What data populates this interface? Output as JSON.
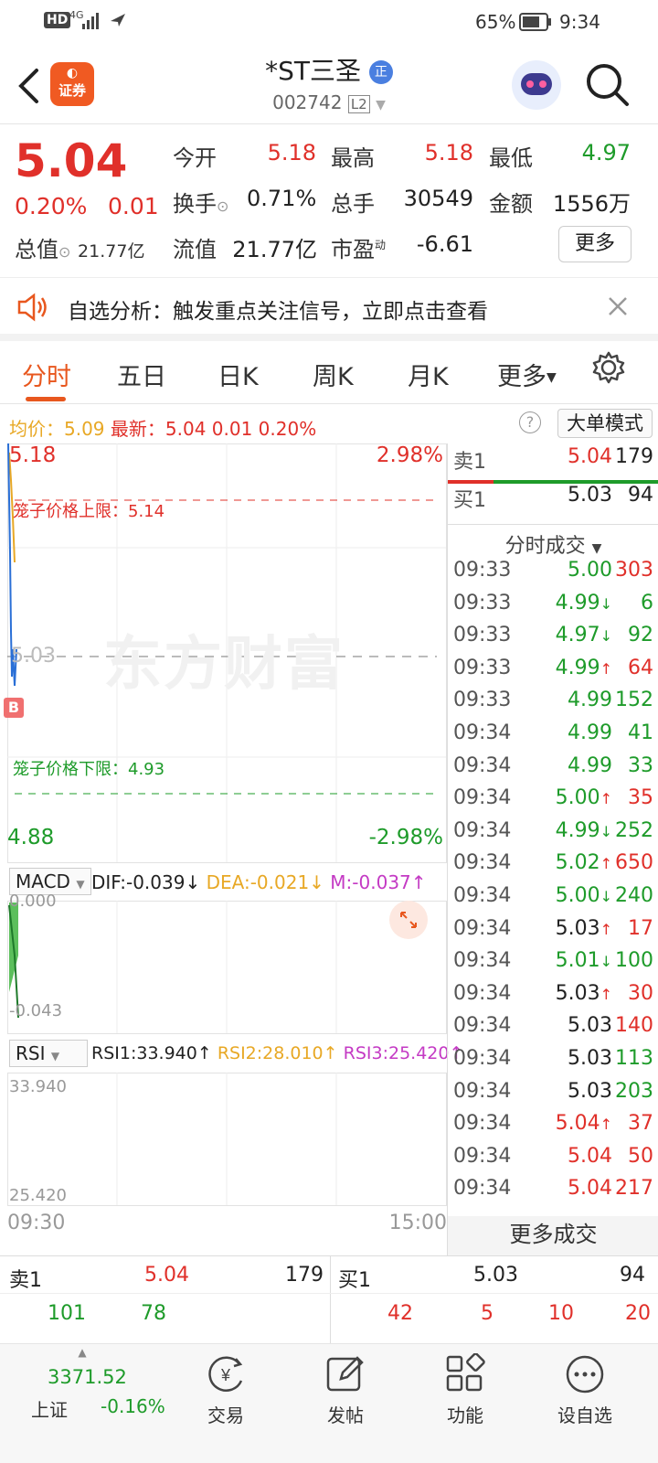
{
  "status": {
    "left_icons": "HD 4G signal",
    "battery": "65%",
    "time": "9:34"
  },
  "header": {
    "logo_text": "证券",
    "title": "*ST三圣",
    "badge": "正",
    "code": "002742",
    "level": "L2"
  },
  "quote": {
    "price": "5.04",
    "change_pct": "0.20%",
    "change": "0.01",
    "open_label": "今开",
    "open": "5.18",
    "high_label": "最高",
    "high": "5.18",
    "low_label": "最低",
    "low": "4.97",
    "turnover_label": "换手",
    "turnover": "0.71%",
    "volume_label": "总手",
    "volume": "30549",
    "amount_label": "金额",
    "amount": "1556万",
    "mktcap_label": "总值",
    "mktcap": "21.77亿",
    "float_label": "流值",
    "float": "21.77亿",
    "pe_label": "市盈",
    "pe_sup": "动",
    "pe": "-6.61",
    "more_button": "更多"
  },
  "alert": {
    "text": "自选分析：触发重点关注信号，立即点击查看"
  },
  "tabs": {
    "items": [
      "分时",
      "五日",
      "日K",
      "周K",
      "月K",
      "更多"
    ],
    "active": "分时"
  },
  "info": {
    "avg_label": "均价：",
    "avg": "5.09",
    "latest_label": "最新：",
    "latest": "5.04",
    "chg": "0.01",
    "chg_pct": "0.20%",
    "mode_button": "大单模式"
  },
  "chart": {
    "high_price": "5.18",
    "high_pct": "2.98%",
    "low_price": "4.88",
    "low_pct": "-2.98%",
    "mid_price": "5.03",
    "upper_limit_label": "笼子价格上限：",
    "upper_limit": "5.14",
    "lower_limit_label": "笼子价格下限：",
    "lower_limit": "4.93",
    "watermark": "东方财富",
    "buy_marker": "B",
    "time_start": "09:30",
    "time_end": "15:00"
  },
  "macd": {
    "selector": "MACD",
    "dif": "DIF:-0.039",
    "dea": "DEA:-0.021",
    "m": "M:-0.037",
    "top": "0.000",
    "bottom": "-0.043"
  },
  "rsi": {
    "selector": "RSI",
    "rsi1": "RSI1:33.940",
    "rsi2": "RSI2:28.010",
    "rsi3": "RSI3:25.420",
    "top": "33.940",
    "bottom": "25.420"
  },
  "side": {
    "ask_label": "卖1",
    "ask_price": "5.04",
    "ask_vol": "179",
    "bid_label": "买1",
    "bid_price": "5.03",
    "bid_vol": "94",
    "ticks_header": "分时成交",
    "more_trades": "更多成交",
    "ticks": [
      {
        "t": "09:33",
        "p": "5.00",
        "v": "303",
        "pc": "green",
        "vc": "red",
        "arrow": ""
      },
      {
        "t": "09:33",
        "p": "4.99",
        "v": "6",
        "pc": "green",
        "vc": "green",
        "arrow": "↓"
      },
      {
        "t": "09:33",
        "p": "4.97",
        "v": "92",
        "pc": "green",
        "vc": "green",
        "arrow": "↓"
      },
      {
        "t": "09:33",
        "p": "4.99",
        "v": "64",
        "pc": "green",
        "vc": "red",
        "arrow": "↑"
      },
      {
        "t": "09:33",
        "p": "4.99",
        "v": "152",
        "pc": "green",
        "vc": "green",
        "arrow": ""
      },
      {
        "t": "09:34",
        "p": "4.99",
        "v": "41",
        "pc": "green",
        "vc": "green",
        "arrow": ""
      },
      {
        "t": "09:34",
        "p": "4.99",
        "v": "33",
        "pc": "green",
        "vc": "green",
        "arrow": ""
      },
      {
        "t": "09:34",
        "p": "5.00",
        "v": "35",
        "pc": "green",
        "vc": "red",
        "arrow": "↑"
      },
      {
        "t": "09:34",
        "p": "4.99",
        "v": "252",
        "pc": "green",
        "vc": "green",
        "arrow": "↓"
      },
      {
        "t": "09:34",
        "p": "5.02",
        "v": "650",
        "pc": "green",
        "vc": "red",
        "arrow": "↑"
      },
      {
        "t": "09:34",
        "p": "5.00",
        "v": "240",
        "pc": "green",
        "vc": "green",
        "arrow": "↓"
      },
      {
        "t": "09:34",
        "p": "5.03",
        "v": "17",
        "pc": "blk",
        "vc": "red",
        "arrow": "↑"
      },
      {
        "t": "09:34",
        "p": "5.01",
        "v": "100",
        "pc": "green",
        "vc": "green",
        "arrow": "↓"
      },
      {
        "t": "09:34",
        "p": "5.03",
        "v": "30",
        "pc": "blk",
        "vc": "red",
        "arrow": "↑"
      },
      {
        "t": "09:34",
        "p": "5.03",
        "v": "140",
        "pc": "blk",
        "vc": "red",
        "arrow": ""
      },
      {
        "t": "09:34",
        "p": "5.03",
        "v": "113",
        "pc": "blk",
        "vc": "green",
        "arrow": ""
      },
      {
        "t": "09:34",
        "p": "5.03",
        "v": "203",
        "pc": "blk",
        "vc": "green",
        "arrow": ""
      },
      {
        "t": "09:34",
        "p": "5.04",
        "v": "37",
        "pc": "red",
        "vc": "red",
        "arrow": "↑"
      },
      {
        "t": "09:34",
        "p": "5.04",
        "v": "50",
        "pc": "red",
        "vc": "red",
        "arrow": ""
      },
      {
        "t": "09:34",
        "p": "5.04",
        "v": "217",
        "pc": "red",
        "vc": "red",
        "arrow": ""
      }
    ]
  },
  "book": {
    "ask_label": "卖1",
    "ask_price": "5.04",
    "ask_vol": "179",
    "bid_label": "买1",
    "bid_price": "5.03",
    "bid_vol": "94",
    "ask_queue": [
      "101",
      "78"
    ],
    "bid_queue": [
      "42",
      "5",
      "10",
      "20"
    ]
  },
  "nav": {
    "index_value": "3371.52",
    "index_name": "上证",
    "index_change": "-0.16%",
    "items": [
      "交易",
      "发帖",
      "功能",
      "设自选"
    ]
  },
  "colors": {
    "up": "#e0302a",
    "down": "#1e9b2a",
    "accent": "#e8571e",
    "avg_line": "#e8a825",
    "price_line": "#2a6fd6"
  }
}
